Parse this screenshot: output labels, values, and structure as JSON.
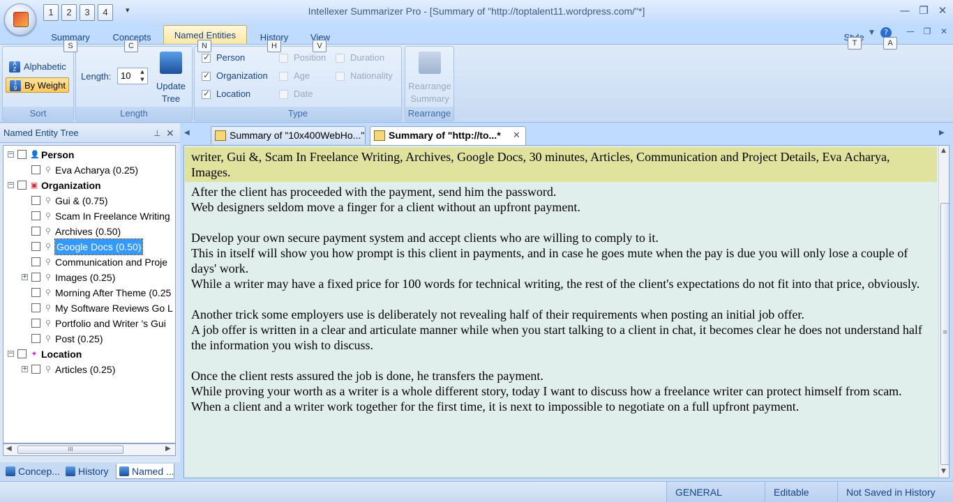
{
  "window": {
    "title": "Intellexer Summarizer Pro - [Summary of \"http://toptalent11.wordpress.com/\"*]",
    "quick_access": [
      "1",
      "2",
      "3",
      "4"
    ],
    "controls": [
      "minimize",
      "restore",
      "close"
    ]
  },
  "ribbon_tabs": [
    {
      "label": "Summary",
      "key": "S"
    },
    {
      "label": "Concepts",
      "key": "C"
    },
    {
      "label": "Named Entities",
      "key": "N",
      "active": true
    },
    {
      "label": "History",
      "key": "H"
    },
    {
      "label": "View",
      "key": "V"
    }
  ],
  "style_menu": {
    "label": "Style",
    "key": "T",
    "help_key": "A"
  },
  "ribbon": {
    "sort": {
      "label": "Sort",
      "alphabetic": "Alphabetic",
      "by_weight": "By Weight",
      "selected": "By Weight"
    },
    "length": {
      "label": "Length",
      "field_label": "Length:",
      "value": "10",
      "update_tree": "Update Tree"
    },
    "type": {
      "label": "Type",
      "checks": [
        {
          "label": "Person",
          "checked": true,
          "enabled": true
        },
        {
          "label": "Organization",
          "checked": true,
          "enabled": true
        },
        {
          "label": "Location",
          "checked": true,
          "enabled": true
        },
        {
          "label": "Position",
          "checked": false,
          "enabled": false
        },
        {
          "label": "Age",
          "checked": false,
          "enabled": false
        },
        {
          "label": "Date",
          "checked": false,
          "enabled": false
        },
        {
          "label": "Duration",
          "checked": false,
          "enabled": false
        },
        {
          "label": "Nationality",
          "checked": false,
          "enabled": false
        }
      ]
    },
    "rearrange": {
      "label": "Rearrange",
      "button": "Rearrange Summary"
    }
  },
  "tree_panel": {
    "title": "Named Entity Tree",
    "nodes": [
      {
        "label": "Person",
        "level": 0,
        "bold": true,
        "icon": "person-icon",
        "expander": "−"
      },
      {
        "label": "Eva Acharya (0.25)",
        "level": 1,
        "icon": "entity-icon"
      },
      {
        "label": "Organization",
        "level": 0,
        "bold": true,
        "icon": "organization-icon",
        "expander": "−"
      },
      {
        "label": "Gui & (0.75)",
        "level": 1,
        "icon": "entity-icon"
      },
      {
        "label": "Scam In Freelance Writing",
        "level": 1,
        "icon": "entity-icon"
      },
      {
        "label": "Archives (0.50)",
        "level": 1,
        "icon": "entity-icon"
      },
      {
        "label": "Google Docs (0.50)",
        "level": 1,
        "icon": "entity-icon",
        "selected": true
      },
      {
        "label": "Communication and Proje",
        "level": 1,
        "icon": "entity-icon"
      },
      {
        "label": "Images (0.25)",
        "level": 1,
        "icon": "entity-icon",
        "expander": "+"
      },
      {
        "label": "Morning After Theme (0.25",
        "level": 1,
        "icon": "entity-icon"
      },
      {
        "label": "My Software Reviews Go L",
        "level": 1,
        "icon": "entity-icon"
      },
      {
        "label": "Portfolio and Writer 's Gui",
        "level": 1,
        "icon": "entity-icon"
      },
      {
        "label": "Post (0.25)",
        "level": 1,
        "icon": "entity-icon"
      },
      {
        "label": "Location",
        "level": 0,
        "bold": true,
        "icon": "location-icon",
        "expander": "−"
      },
      {
        "label": "Articles (0.25)",
        "level": 1,
        "icon": "entity-icon",
        "expander": "+"
      }
    ],
    "scroll_grip": "III"
  },
  "bottom_tabs": [
    {
      "label": "Concep...",
      "active": false
    },
    {
      "label": "History",
      "active": false
    },
    {
      "label": "Named ...",
      "active": true
    }
  ],
  "doc_tabs": [
    {
      "label": "Summary of \"10x400WebHo...\"",
      "active": false
    },
    {
      "label": "Summary of \"http://to...*",
      "active": true
    }
  ],
  "editor": {
    "keywords": "writer, Gui &, Scam In Freelance Writing, Archives, Google Docs, 30 minutes, Articles, Communication and Project Details, Eva Acharya, Images.",
    "paragraphs": [
      "After the client has proceeded with the payment, send him the password.",
      "Web designers seldom move a finger for a client without an upfront payment.",
      "",
      "Develop your own secure payment system and accept clients who are willing to comply to it.",
      "This in itself will show you how prompt is this client in payments, and in case he goes mute when the pay is due you will only lose a couple of days' work.",
      "While a writer may have a fixed price for 100 words for technical writing, the rest of the client's expectations do not fit into that price, obviously.",
      "",
      "Another trick some employers use is deliberately not revealing half of their requirements when posting an initial job offer.",
      "A job offer is written in a clear and articulate manner while when you start talking to a client in chat, it becomes clear he does not understand half the information you wish to discuss.",
      "",
      "Once the client rests assured the job is done, he transfers the payment.",
      "While proving your worth as a writer is a whole different story, today I want to discuss how a freelance writer can protect himself from scam.",
      "When a client and a writer work together for the first time, it is next to impossible to negotiate on a full upfront payment."
    ]
  },
  "status_bar": [
    "GENERAL",
    "Editable",
    "Not Saved in History"
  ]
}
